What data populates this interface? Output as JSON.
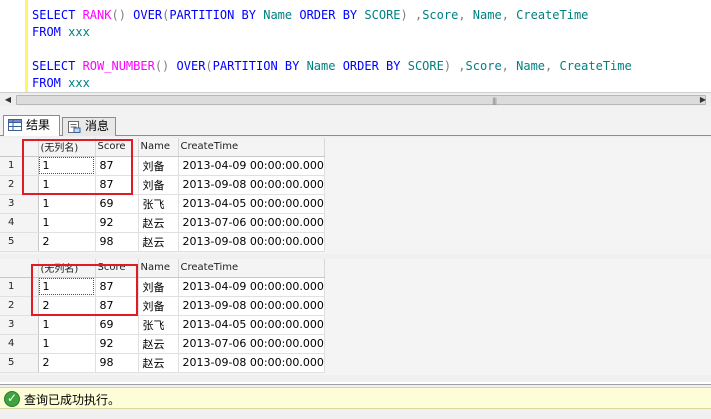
{
  "editor": {
    "lines": [
      [
        {
          "t": "SELECT ",
          "c": "kw"
        },
        {
          "t": "RANK",
          "c": "fn"
        },
        {
          "t": "() ",
          "c": "sy"
        },
        {
          "t": "OVER",
          "c": "kw"
        },
        {
          "t": "(",
          "c": "sy"
        },
        {
          "t": "PARTITION BY ",
          "c": "kw"
        },
        {
          "t": "Name ",
          "c": "id"
        },
        {
          "t": "ORDER BY ",
          "c": "kw"
        },
        {
          "t": "SCORE",
          "c": "id"
        },
        {
          "t": ") ,",
          "c": "sy"
        },
        {
          "t": "Score",
          "c": "id"
        },
        {
          "t": ", ",
          "c": "sy"
        },
        {
          "t": "Name",
          "c": "id"
        },
        {
          "t": ", ",
          "c": "sy"
        },
        {
          "t": "CreateTime",
          "c": "id"
        }
      ],
      [
        {
          "t": "FROM ",
          "c": "kw"
        },
        {
          "t": "xxx",
          "c": "id"
        }
      ],
      [],
      [
        {
          "t": "SELECT ",
          "c": "kw"
        },
        {
          "t": "ROW_NUMBER",
          "c": "fn"
        },
        {
          "t": "() ",
          "c": "sy"
        },
        {
          "t": "OVER",
          "c": "kw"
        },
        {
          "t": "(",
          "c": "sy"
        },
        {
          "t": "PARTITION BY ",
          "c": "kw"
        },
        {
          "t": "Name ",
          "c": "id"
        },
        {
          "t": "ORDER BY ",
          "c": "kw"
        },
        {
          "t": "SCORE",
          "c": "id"
        },
        {
          "t": ") ,",
          "c": "sy"
        },
        {
          "t": "Score",
          "c": "id"
        },
        {
          "t": ", ",
          "c": "sy"
        },
        {
          "t": "Name",
          "c": "id"
        },
        {
          "t": ", ",
          "c": "sy"
        },
        {
          "t": "CreateTime",
          "c": "id"
        }
      ],
      [
        {
          "t": "FROM ",
          "c": "kw"
        },
        {
          "t": "xxx",
          "c": "id"
        }
      ]
    ]
  },
  "scrollbar": {
    "left_arrow": "◀",
    "right_arrow": "▶",
    "grip": "|||"
  },
  "tabs": [
    {
      "label": "结果",
      "icon": "grid-icon",
      "active": true
    },
    {
      "label": "消息",
      "icon": "message-icon",
      "active": false
    }
  ],
  "grids": [
    {
      "columns": [
        "(无列名)",
        "Score",
        "Name",
        "CreateTime"
      ],
      "rows": [
        {
          "n": "1",
          "cells": [
            "1",
            "87",
            "刘备",
            "2013-04-09 00:00:00.000"
          ]
        },
        {
          "n": "2",
          "cells": [
            "1",
            "87",
            "刘备",
            "2013-09-08 00:00:00.000"
          ]
        },
        {
          "n": "3",
          "cells": [
            "1",
            "69",
            "张飞",
            "2013-04-05 00:00:00.000"
          ]
        },
        {
          "n": "4",
          "cells": [
            "1",
            "92",
            "赵云",
            "2013-07-06 00:00:00.000"
          ]
        },
        {
          "n": "5",
          "cells": [
            "2",
            "98",
            "赵云",
            "2013-09-08 00:00:00.000"
          ]
        }
      ]
    },
    {
      "columns": [
        "(无列名)",
        "Score",
        "Name",
        "CreateTime"
      ],
      "rows": [
        {
          "n": "1",
          "cells": [
            "1",
            "87",
            "刘备",
            "2013-04-09 00:00:00.000"
          ]
        },
        {
          "n": "2",
          "cells": [
            "2",
            "87",
            "刘备",
            "2013-09-08 00:00:00.000"
          ]
        },
        {
          "n": "3",
          "cells": [
            "1",
            "69",
            "张飞",
            "2013-04-05 00:00:00.000"
          ]
        },
        {
          "n": "4",
          "cells": [
            "1",
            "92",
            "赵云",
            "2013-07-06 00:00:00.000"
          ]
        },
        {
          "n": "5",
          "cells": [
            "2",
            "98",
            "赵云",
            "2013-09-08 00:00:00.000"
          ]
        }
      ]
    }
  ],
  "status": {
    "icon": "success-check-icon",
    "message": "查询已成功执行。"
  },
  "colors": {
    "keyword": "#0000ff",
    "function": "#ff00ff",
    "identifier": "#008080",
    "symbol": "#808080",
    "highlight": "#e11b22",
    "changebar": "#fff36a"
  }
}
